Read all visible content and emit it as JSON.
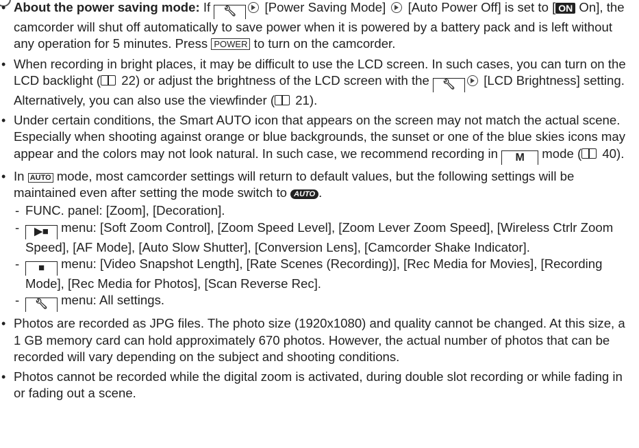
{
  "bullets": {
    "b1": {
      "lead": "About the power saving mode:",
      "t1": " If ",
      "t2": " [Power Saving Mode] ",
      "t3": " [Auto Power Off] is set to [",
      "on": "ON",
      "t4": " On], the camcorder will shut off automatically to save power when it is powered by a battery pack and is left without any operation for 5 minutes. Press ",
      "power": "POWER",
      "t5": " to turn on the camcorder."
    },
    "b2": {
      "t1": "When recording in bright places, it may be difficult to use the LCD screen. In such cases, you can turn on the LCD backlight (",
      "p1": " 22) or adjust the brightness of the LCD screen with the ",
      "t2": " [LCD Brightness] setting. Alternatively, you can also use the viewfinder (",
      "p2": " 21)."
    },
    "b3": {
      "t1": "Under certain conditions, the Smart AUTO icon that appears on the screen may not match the actual scene. Especially when shooting against orange or blue backgrounds, the sunset or one of the blue skies icons may appear and the colors may not look natural. In such case, we recommend recording in ",
      "m": "M",
      "t2": " mode (",
      "p1": " 40)."
    },
    "b4": {
      "t0": "In ",
      "auto": "AUTO",
      "t1": " mode, most camcorder settings will return to default values, but the following settings will be maintained even after setting the mode switch to ",
      "auto2": "AUTO",
      "t2": ".",
      "s1": "FUNC. panel: [Zoom], [Decoration].",
      "s2": " menu: [Soft Zoom Control], [Zoom Speed Level], [Zoom Lever Zoom Speed], [Wireless Ctrlr Zoom Speed], [AF Mode], [Auto Slow Shutter], [Conversion Lens], [Camcorder Shake Indicator].",
      "s3": " menu: [Video Snapshot Length], [Rate Scenes (Recording)], [Rec Media for Movies], [Recording Mode], [Rec Media for Photos], [Scan Reverse Rec].",
      "s4": " menu: All settings."
    },
    "b5": "Photos are recorded as JPG files. The photo size (1920x1080) and quality cannot be changed. At this size, a 1 GB memory card can hold approximately 670 photos. However, the actual number of photos that can be recorded will vary depending on the subject and shooting conditions.",
    "b6": "Photos cannot be recorded while the digital zoom is activated, during double slot recording or while fading in or fading out a scene."
  },
  "icons": {
    "setup": "wrench-tab-icon",
    "camera": "camera-tab-icon",
    "playback": "playback-tab-icon",
    "arrow": "arrow-circle-icon",
    "book": "page-reference-icon"
  }
}
